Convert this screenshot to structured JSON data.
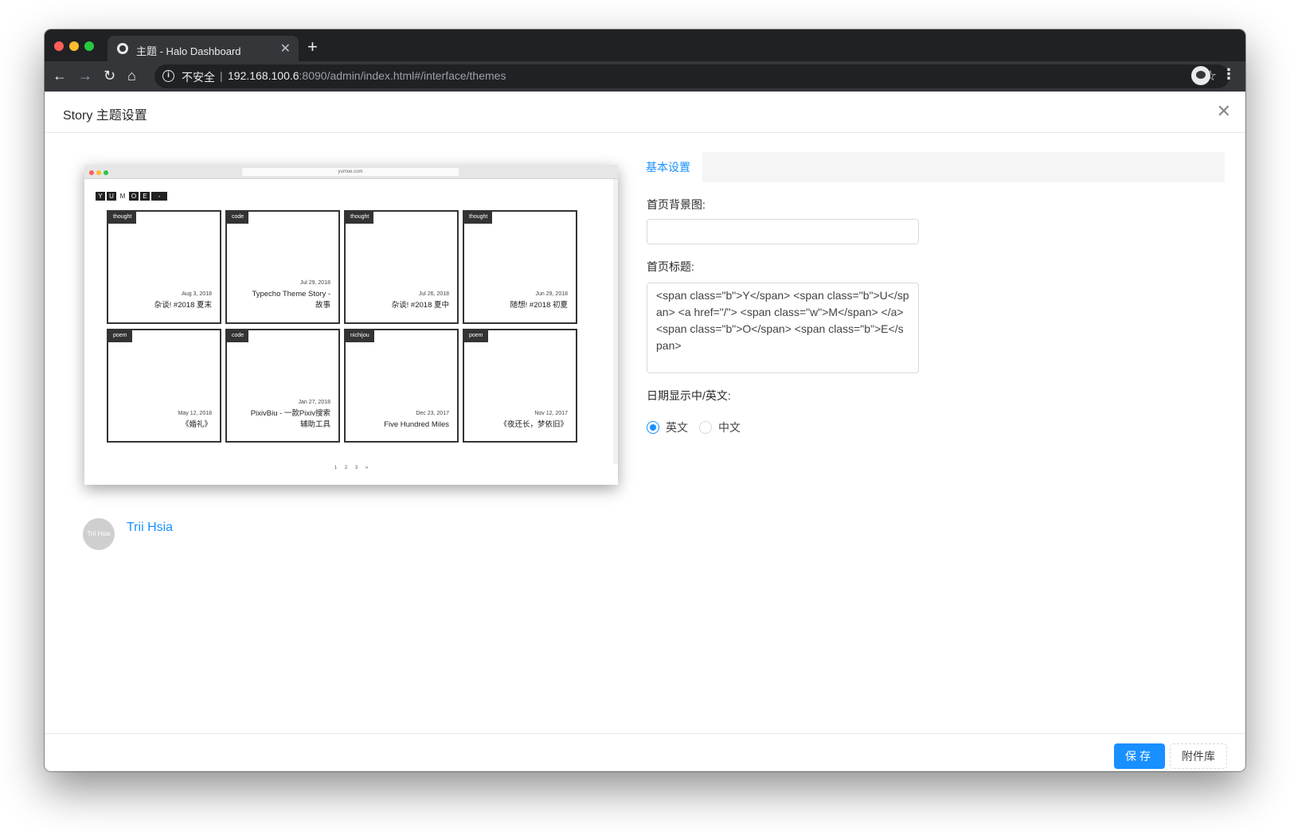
{
  "browser": {
    "tab_title": "主题 - Halo Dashboard",
    "new_tab": "+",
    "tab_close": "✕",
    "insecure_label": "不安全",
    "url_host": "192.168.100.6",
    "url_path": ":8090/admin/index.html#/interface/themes"
  },
  "modal": {
    "title": "Story 主题设置",
    "close": "✕"
  },
  "preview": {
    "url": "yumoe.com",
    "logo": [
      "Y",
      "U",
      "M",
      "O",
      "E",
      "-"
    ],
    "cards": [
      {
        "category": "thought",
        "date": "Aug 3, 2018",
        "title": "杂谈! #2018 夏末"
      },
      {
        "category": "code",
        "date": "Jul 29, 2018",
        "title": "Typecho Theme Story - 故事"
      },
      {
        "category": "thought",
        "date": "Jul 26, 2018",
        "title": "杂谈! #2018 夏中"
      },
      {
        "category": "thought",
        "date": "Jun 29, 2018",
        "title": "随想! #2018 初夏"
      },
      {
        "category": "poem",
        "date": "May 12, 2018",
        "title": "《婚礼》"
      },
      {
        "category": "code",
        "date": "Jan 27, 2018",
        "title": "PixivBiu - 一款Pixiv搜索 辅助工具"
      },
      {
        "category": "nichijou",
        "date": "Dec 23, 2017",
        "title": "Five Hundred Miles"
      },
      {
        "category": "poem",
        "date": "Nov 12, 2017",
        "title": "《夜还长，梦依旧》"
      }
    ],
    "pagination": "1 2 3 »"
  },
  "author": {
    "avatar_text": "Trii Hsia",
    "name": "Trii Hsia"
  },
  "form": {
    "tab_label": "基本设置",
    "bg_label": "首页背景图:",
    "bg_value": "",
    "title_label": "首页标题:",
    "title_value": "<span class=\"b\">Y</span> <span class=\"b\">U</span> <a href=\"/\"> <span class=\"w\">M</span> </a> <span class=\"b\">O</span> <span class=\"b\">E</span>",
    "date_label": "日期显示中/英文:",
    "radio_en": "英文",
    "radio_zh": "中文",
    "selected": "英文"
  },
  "footer": {
    "save": "保存",
    "attachments": "附件库"
  },
  "colors": {
    "primary": "#1890ff",
    "chrome_dark": "#202124",
    "chrome_mid": "#35363a"
  }
}
